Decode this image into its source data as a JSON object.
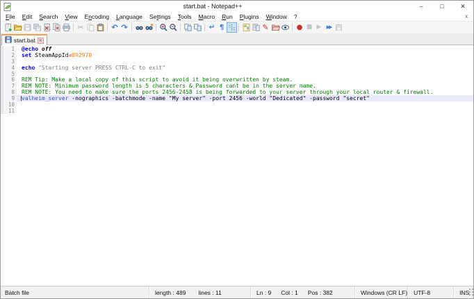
{
  "window": {
    "title": "start.bat - Notepad++"
  },
  "titlebar": {
    "minimize": "–",
    "maximize": "□",
    "close": "✕"
  },
  "menu": {
    "items": [
      {
        "id": "file",
        "label": "File",
        "u": 0
      },
      {
        "id": "edit",
        "label": "Edit",
        "u": 0
      },
      {
        "id": "search",
        "label": "Search",
        "u": 0
      },
      {
        "id": "view",
        "label": "View",
        "u": 0
      },
      {
        "id": "encoding",
        "label": "Encoding",
        "u": 1
      },
      {
        "id": "language",
        "label": "Language",
        "u": 0
      },
      {
        "id": "settings",
        "label": "Settings",
        "u": 2
      },
      {
        "id": "tools",
        "label": "Tools",
        "u": 0
      },
      {
        "id": "macro",
        "label": "Macro",
        "u": 0
      },
      {
        "id": "run",
        "label": "Run",
        "u": 0
      },
      {
        "id": "plugins",
        "label": "Plugins",
        "u": 0
      },
      {
        "id": "window",
        "label": "Window",
        "u": 0
      },
      {
        "id": "help",
        "label": "?",
        "u": -1
      }
    ],
    "close_glyph": "x"
  },
  "toolbar": {
    "groups": [
      [
        "new-file",
        "open-file",
        "save",
        "save-all",
        "close-document",
        "close-all-documents",
        "print"
      ],
      [
        "cut",
        "copy",
        "paste"
      ],
      [
        "undo",
        "redo"
      ],
      [
        "find",
        "replace"
      ],
      [
        "zoom-in",
        "zoom-out"
      ],
      [
        "sync-vertical",
        "sync-horizontal"
      ],
      [
        "word-wrap",
        "show-all-characters",
        "indent-guide"
      ],
      [
        "document-map",
        "document-list",
        "function-list",
        "folder-as-workspace",
        "monitoring"
      ],
      [
        "macro-record",
        "macro-stop",
        "macro-playback",
        "macro-run-multiple",
        "macro-save"
      ]
    ],
    "pressed": "indent-guide",
    "disabled": [
      "save",
      "save-all",
      "cut",
      "copy",
      "macro-stop",
      "macro-playback",
      "macro-save"
    ]
  },
  "tab": {
    "label": "start.bat",
    "saved": true,
    "close_glyph": "✕"
  },
  "editor": {
    "lines": [
      {
        "n": 1,
        "tokens": [
          {
            "t": "@echo",
            "s": "kw"
          },
          {
            "t": " ",
            "s": "d"
          },
          {
            "t": "off",
            "s": "off"
          }
        ]
      },
      {
        "n": 2,
        "tokens": [
          {
            "t": "set",
            "s": "kw"
          },
          {
            "t": " SteamAppId",
            "s": "d"
          },
          {
            "t": "=",
            "s": "op"
          },
          {
            "t": "892970",
            "s": "num"
          }
        ]
      },
      {
        "n": 3,
        "tokens": []
      },
      {
        "n": 4,
        "tokens": [
          {
            "t": "echo",
            "s": "kw"
          },
          {
            "t": " ",
            "s": "d"
          },
          {
            "t": "\"Starting server PRESS CTRL-C to exit\"",
            "s": "str"
          }
        ]
      },
      {
        "n": 5,
        "tokens": []
      },
      {
        "n": 6,
        "tokens": [
          {
            "t": "REM Tip: Make a local copy of this script to avoid it being overwritten by steam.",
            "s": "com"
          }
        ]
      },
      {
        "n": 7,
        "tokens": [
          {
            "t": "REM NOTE: Minimum password length is 5 characters & Password cant be in the server name.",
            "s": "com"
          }
        ]
      },
      {
        "n": 8,
        "tokens": [
          {
            "t": "REM NOTE: You need to make sure the ports 2456-2458 is being forwarded to your server through your local router & firewall.",
            "s": "com"
          }
        ]
      },
      {
        "n": 9,
        "current": true,
        "tokens": [
          {
            "t": "valheim_server",
            "s": "cmd"
          },
          {
            "t": " -nographics -batchmode -name \"My server\" -port 2456 -world \"Dedicated\" -password \"secret\"",
            "s": "d"
          }
        ]
      },
      {
        "n": 10,
        "tokens": []
      },
      {
        "n": 11,
        "tokens": []
      }
    ]
  },
  "statusbar": {
    "doc_type": "Batch file",
    "length_label": "length : 489",
    "lines_label": "lines : 11",
    "ln": "Ln : 9",
    "col": "Col : 1",
    "pos": "Pos : 382",
    "eol": "Windows (CR LF)",
    "encoding": "UTF-8",
    "mode": "INS"
  },
  "colors": {
    "active_tab_top": "#f7a247",
    "current_line_bg": "#e8e8ff",
    "keyword": "#0000ff",
    "comment": "#008000",
    "number": "#ff8000",
    "operator": "#ff0000",
    "string": "#808080",
    "command": "#2a56c6",
    "pressed_button_bg": "#cde4f7"
  }
}
